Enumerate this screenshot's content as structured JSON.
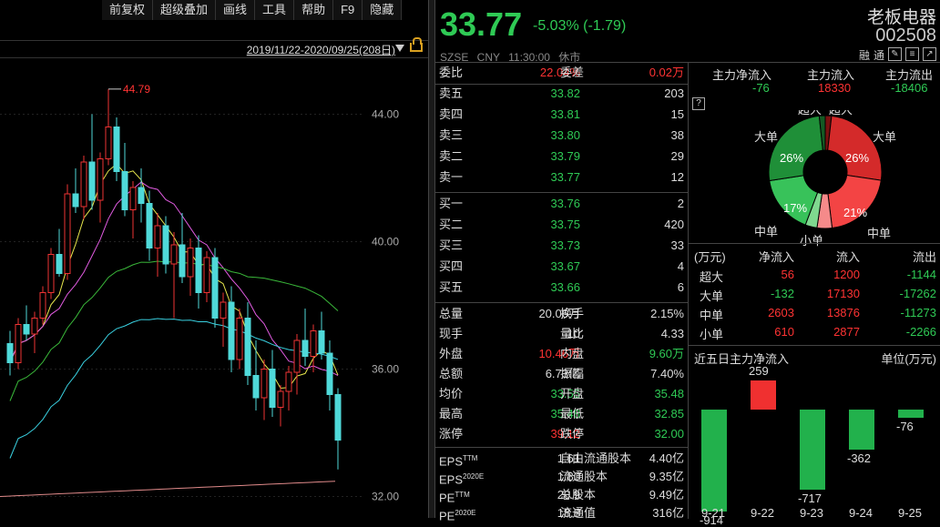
{
  "toolbar": [
    "前复权",
    "超级叠加",
    "画线",
    "工具",
    "帮助",
    "F9",
    "隐藏"
  ],
  "range": "2019/11/22-2020/09/25(208日)",
  "chart_data": {
    "type": "candlestick",
    "y_ticks": [
      "44.00",
      "40.00",
      "36.00",
      "32.00"
    ],
    "ylim": [
      31.5,
      45.5
    ],
    "high_marker": "44.79",
    "candles": [
      [
        36.8,
        37.2,
        35.8,
        36.2
      ],
      [
        36.2,
        37.6,
        36.0,
        37.4
      ],
      [
        37.4,
        38.0,
        36.9,
        37.1
      ],
      [
        37.1,
        37.8,
        36.5,
        37.6
      ],
      [
        37.6,
        38.6,
        37.4,
        38.4
      ],
      [
        38.4,
        39.8,
        38.2,
        39.6
      ],
      [
        39.6,
        40.4,
        38.9,
        39.0
      ],
      [
        39.0,
        41.8,
        38.8,
        41.5
      ],
      [
        41.5,
        42.3,
        40.9,
        41.1
      ],
      [
        41.1,
        42.7,
        40.7,
        42.5
      ],
      [
        42.5,
        44.0,
        41.0,
        41.3
      ],
      [
        41.3,
        42.8,
        40.6,
        42.6
      ],
      [
        42.6,
        44.79,
        42.4,
        43.6
      ],
      [
        43.6,
        43.9,
        41.9,
        42.2
      ],
      [
        42.2,
        43.1,
        40.8,
        41.0
      ],
      [
        41.0,
        41.9,
        40.1,
        41.7
      ],
      [
        41.7,
        42.3,
        40.6,
        41.2
      ],
      [
        41.2,
        41.6,
        39.4,
        39.8
      ],
      [
        39.8,
        40.9,
        38.9,
        40.5
      ],
      [
        40.5,
        40.8,
        39.0,
        39.3
      ],
      [
        39.3,
        40.3,
        37.6,
        39.9
      ],
      [
        39.9,
        40.9,
        38.7,
        38.9
      ],
      [
        38.9,
        40.1,
        38.3,
        39.8
      ],
      [
        39.8,
        40.2,
        37.9,
        38.4
      ],
      [
        38.4,
        39.7,
        38.1,
        39.5
      ],
      [
        39.5,
        39.8,
        37.3,
        37.6
      ],
      [
        37.6,
        38.4,
        36.7,
        38.1
      ],
      [
        38.1,
        38.6,
        35.9,
        36.3
      ],
      [
        36.3,
        37.9,
        36.0,
        37.6
      ],
      [
        37.6,
        38.1,
        35.5,
        35.8
      ],
      [
        35.8,
        36.9,
        34.7,
        35.1
      ],
      [
        35.1,
        36.3,
        34.4,
        36.0
      ],
      [
        36.0,
        36.6,
        34.5,
        34.8
      ],
      [
        34.8,
        35.5,
        34.2,
        35.3
      ],
      [
        35.3,
        36.1,
        34.7,
        35.9
      ],
      [
        35.9,
        37.1,
        35.2,
        36.9
      ],
      [
        36.9,
        37.9,
        36.1,
        36.4
      ],
      [
        36.4,
        37.4,
        35.9,
        37.2
      ],
      [
        37.2,
        37.8,
        36.3,
        36.5
      ],
      [
        36.5,
        36.9,
        34.7,
        35.2
      ],
      [
        35.2,
        35.4,
        32.85,
        33.77
      ]
    ]
  },
  "quote": {
    "price": "33.77",
    "change": "-5.03% (-1.79)",
    "name": "老板电器",
    "code": "002508",
    "info": "SZSE CNY 11:30:00 休市",
    "icons": [
      "融",
      "通"
    ]
  },
  "orderbook": {
    "ratio_label": "委比",
    "ratio": "22.04%",
    "diff_label": "委差",
    "diff": "0.02万",
    "asks": [
      {
        "label": "卖五",
        "price": "33.82",
        "vol": "203"
      },
      {
        "label": "卖四",
        "price": "33.81",
        "vol": "15"
      },
      {
        "label": "卖三",
        "price": "33.80",
        "vol": "38"
      },
      {
        "label": "卖二",
        "price": "33.79",
        "vol": "29"
      },
      {
        "label": "卖一",
        "price": "33.77",
        "vol": "12"
      }
    ],
    "bids": [
      {
        "label": "买一",
        "price": "33.76",
        "vol": "2"
      },
      {
        "label": "买二",
        "price": "33.75",
        "vol": "420"
      },
      {
        "label": "买三",
        "price": "33.73",
        "vol": "33"
      },
      {
        "label": "买四",
        "price": "33.67",
        "vol": "4"
      },
      {
        "label": "买五",
        "price": "33.66",
        "vol": "6"
      }
    ]
  },
  "stats": [
    {
      "l1": "总量",
      "v1": "20.06万",
      "c1": "white",
      "l2": "换手",
      "v2": "2.15%",
      "c2": "white"
    },
    {
      "l1": "现手",
      "v1": "10",
      "c1": "white",
      "l2": "量比",
      "v2": "4.33",
      "c2": "white"
    },
    {
      "l1": "外盘",
      "v1": "10.46万",
      "c1": "red",
      "l2": "内盘",
      "v2": "9.60万",
      "c2": "green"
    },
    {
      "l1": "总额",
      "v1": "6.73亿",
      "c1": "white",
      "l2": "振幅",
      "v2": "7.40%",
      "c2": "white"
    },
    {
      "l1": "均价",
      "v1": "33.55",
      "c1": "green",
      "l2": "开盘",
      "v2": "35.48",
      "c2": "green"
    },
    {
      "l1": "最高",
      "v1": "35.48",
      "c1": "green",
      "l2": "最低",
      "v2": "32.85",
      "c2": "green"
    },
    {
      "l1": "涨停",
      "v1": "39.12",
      "c1": "red",
      "l2": "跌停",
      "v2": "32.00",
      "c2": "green"
    }
  ],
  "fundamentals": [
    {
      "l1": "EPS",
      "sup": "TTM",
      "v1": "1.61",
      "l2": "自由流通股本",
      "v2": "4.40亿"
    },
    {
      "l1": "EPS",
      "sup": "2020E",
      "v1": "1.80",
      "l2": "流通股本",
      "v2": "9.35亿"
    },
    {
      "l1": "PE",
      "sup": "TTM",
      "v1": "20.9",
      "l2": "总股本",
      "v2": "9.49亿"
    },
    {
      "l1": "PE",
      "sup": "2020E",
      "v1": "18.8",
      "l2": "流通值",
      "v2": "316亿"
    }
  ],
  "flows": {
    "h1": "主力净流入",
    "v1": "-76",
    "h2": "主力流入",
    "v2": "18330",
    "h3": "主力流出",
    "v3": "-18406",
    "donut_labels": {
      "super_left": "超大",
      "super_right": "超大",
      "big_left": "大单",
      "big_right": "大单",
      "mid_left": "中单",
      "mid_right": "中单",
      "small": "小单"
    },
    "donut_pcts": {
      "big_out": "26%",
      "big_in": "26%",
      "mid_out": "17%",
      "mid_in": "21%"
    },
    "donut_slices": [
      {
        "name": "super-in",
        "value": 1200,
        "color": "#7a1010"
      },
      {
        "name": "big-in",
        "value": 17130,
        "color": "#d42a2a"
      },
      {
        "name": "mid-in",
        "value": 13876,
        "color": "#f34444"
      },
      {
        "name": "small-in",
        "value": 2877,
        "color": "#f58a8a"
      },
      {
        "name": "small-out",
        "value": 2266,
        "color": "#7fd88f"
      },
      {
        "name": "mid-out",
        "value": 11273,
        "color": "#38c25a"
      },
      {
        "name": "big-out",
        "value": 17262,
        "color": "#1f8f38"
      },
      {
        "name": "super-out",
        "value": 1144,
        "color": "#145a24"
      }
    ],
    "table_head": [
      "(万元)",
      "净流入",
      "流入",
      "流出"
    ],
    "table": [
      {
        "k": "超大",
        "net": "56",
        "in": "1200",
        "out": "-1144",
        "netc": "red"
      },
      {
        "k": "大单",
        "net": "-132",
        "in": "17130",
        "out": "-17262",
        "netc": "green"
      },
      {
        "k": "中单",
        "net": "2603",
        "in": "13876",
        "out": "-11273",
        "netc": "red"
      },
      {
        "k": "小单",
        "net": "610",
        "in": "2877",
        "out": "-2266",
        "netc": "red"
      }
    ],
    "five_title": "近五日主力净流入",
    "five_unit": "单位(万元)",
    "five_days": [
      {
        "d": "9-21",
        "v": -914
      },
      {
        "d": "9-22",
        "v": 259
      },
      {
        "d": "9-23",
        "v": -717
      },
      {
        "d": "9-24",
        "v": -362
      },
      {
        "d": "9-25",
        "v": -76
      }
    ]
  }
}
